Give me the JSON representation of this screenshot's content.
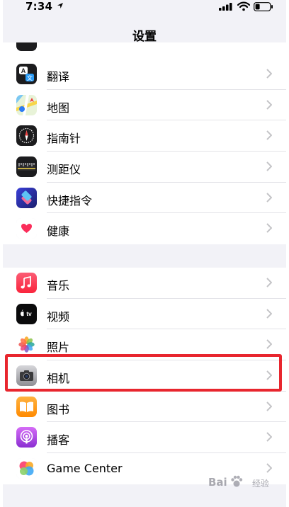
{
  "status_bar": {
    "time": "7:34"
  },
  "nav": {
    "title": "设置"
  },
  "group1": [
    {
      "label": "翻译",
      "icon": "translate-icon"
    },
    {
      "label": "地图",
      "icon": "maps-icon"
    },
    {
      "label": "指南针",
      "icon": "compass-icon"
    },
    {
      "label": "测距仪",
      "icon": "measure-icon"
    },
    {
      "label": "快捷指令",
      "icon": "shortcuts-icon"
    },
    {
      "label": "健康",
      "icon": "health-icon"
    }
  ],
  "group2": [
    {
      "label": "音乐",
      "icon": "music-icon"
    },
    {
      "label": "视频",
      "icon": "tv-icon"
    },
    {
      "label": "照片",
      "icon": "photos-icon"
    },
    {
      "label": "相机",
      "icon": "camera-icon"
    },
    {
      "label": "图书",
      "icon": "books-icon"
    },
    {
      "label": "播客",
      "icon": "podcasts-icon"
    },
    {
      "label": "Game Center",
      "icon": "game-center-icon"
    }
  ],
  "icons": {
    "tv_text": "tv",
    "translate_glyph_a": "A",
    "translate_glyph_b": "文"
  },
  "watermark": {
    "text": "Bai",
    "subtext": "经验"
  },
  "colors": {
    "highlight": "#e8262e",
    "background": "#f2f2f7"
  }
}
